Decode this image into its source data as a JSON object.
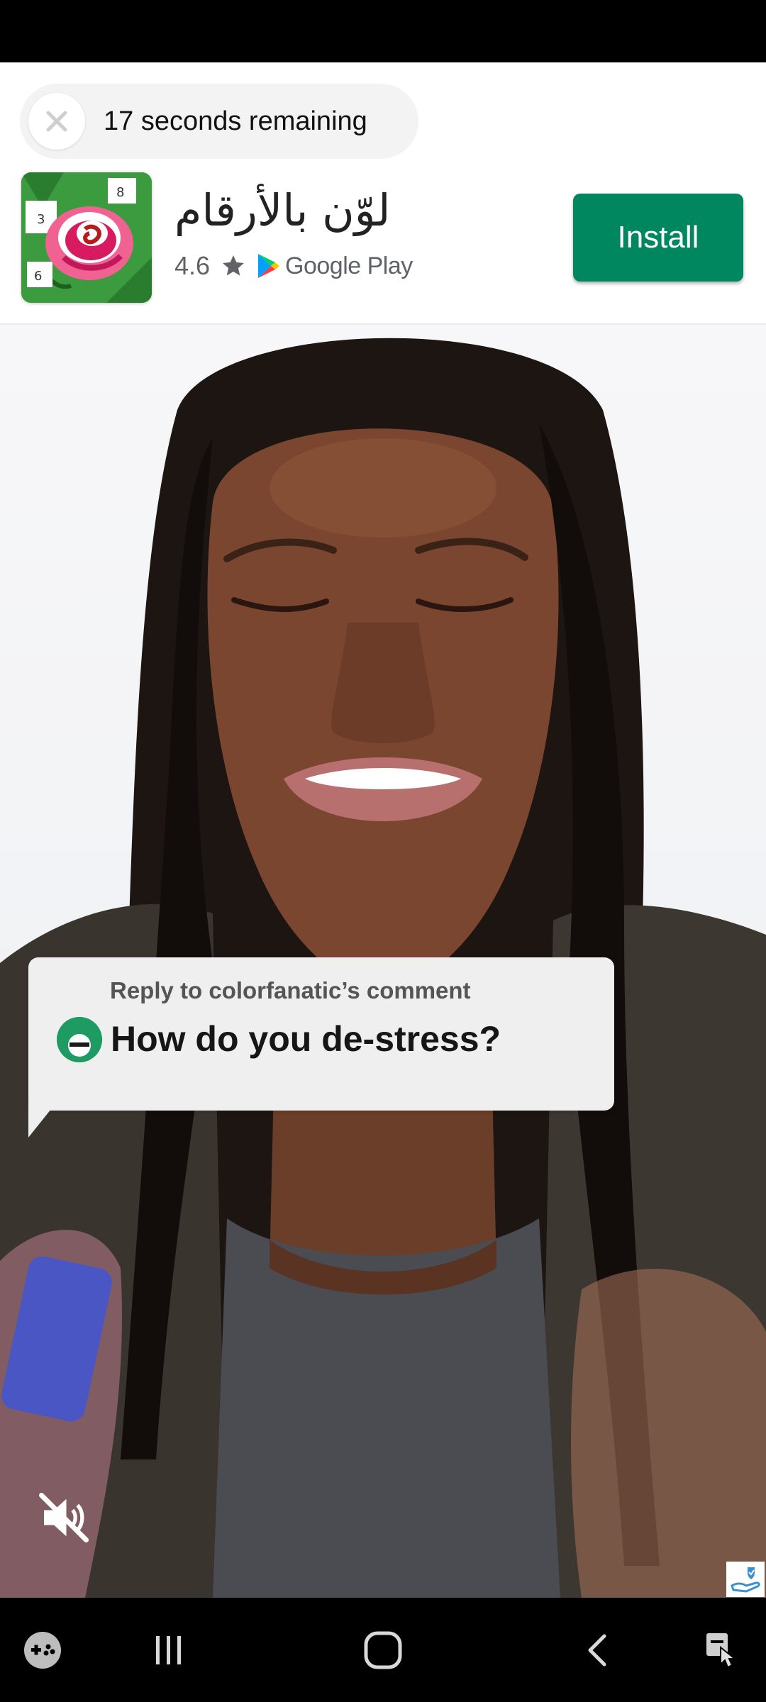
{
  "ad": {
    "countdown": "17 seconds remaining",
    "app_name": "لوّن بالأرقام",
    "rating": "4.6",
    "store": "Google Play",
    "install_label": "Install"
  },
  "video": {
    "comment_header": "Reply to colorfanatic’s comment",
    "comment_question": "How do you de-stress?"
  },
  "icons": {
    "close": "close-icon",
    "star": "star-icon",
    "play_logo": "google-play-logo-icon",
    "mute": "mute-icon",
    "badge": "hand-check-badge-icon",
    "game": "game-controller-icon",
    "recents": "recents-icon",
    "home": "home-icon",
    "back": "back-icon",
    "accessibility": "accessibility-icon"
  },
  "colors": {
    "install_green": "#01875f",
    "pill_bg": "#f3f3f3",
    "bubble_bg": "#efefef"
  }
}
